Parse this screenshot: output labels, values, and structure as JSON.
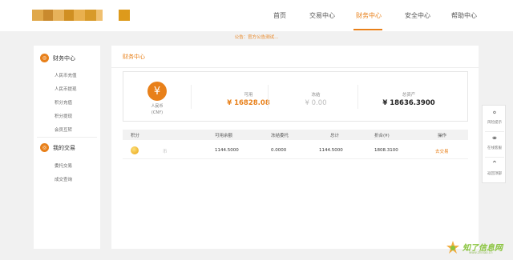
{
  "header": {
    "nav": [
      {
        "label": "首页",
        "active": false
      },
      {
        "label": "交易中心",
        "active": false
      },
      {
        "label": "财务中心",
        "active": true
      },
      {
        "label": "安全中心",
        "active": false
      },
      {
        "label": "帮助中心",
        "active": false
      }
    ]
  },
  "notice": "公告：官方公告测试...",
  "sidebar": {
    "groups": [
      {
        "title": "财务中心",
        "icon": "finance-icon",
        "items": [
          "人民币充值",
          "人民币提现",
          "积分充值",
          "积分提现",
          "会员互转"
        ]
      },
      {
        "title": "我的交易",
        "icon": "trade-icon",
        "items": [
          "委托交易",
          "成交查询"
        ]
      }
    ]
  },
  "main": {
    "title": "财务中心",
    "currency": {
      "symbol": "¥",
      "name": "人民币",
      "code": "(CNY)"
    },
    "summary": [
      {
        "label": "可用",
        "value": "¥ 16828.08",
        "color": "#e8801a"
      },
      {
        "label": "冻结",
        "value": "¥ 0.00",
        "color": "#bbbbbb"
      },
      {
        "label": "总资产",
        "value": "¥ 18636.3900",
        "color": "#222222"
      }
    ],
    "table": {
      "headers": [
        "积分",
        "可用余额",
        "冻结委托",
        "总计",
        "折合(¥)",
        "操作"
      ],
      "rows": [
        {
          "name": "币",
          "available": "1144.5000",
          "frozen": "0.0000",
          "total": "1144.5000",
          "equiv": "1808.3100",
          "action": "去交易"
        }
      ]
    }
  },
  "tools": [
    {
      "label": "风险提示",
      "icon": "lightbulb-icon"
    },
    {
      "label": "在线客服",
      "icon": "headset-icon"
    },
    {
      "label": "返回顶部",
      "icon": "chevron-up-icon"
    }
  ],
  "watermark": {
    "text": "知了信息网",
    "url": "www.zhiliao.cn"
  },
  "colors": {
    "accent": "#e8801a",
    "logo": "#d9a03a"
  }
}
